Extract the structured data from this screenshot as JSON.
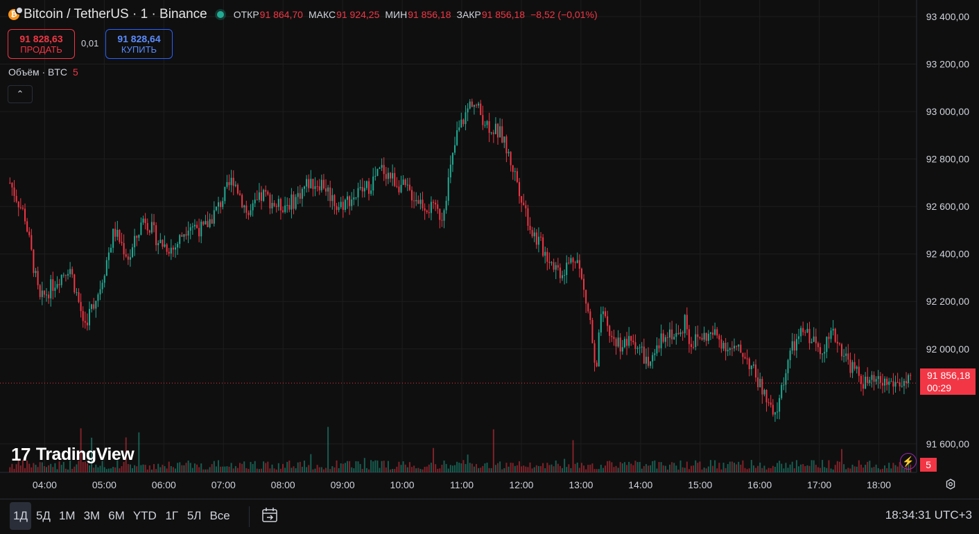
{
  "legend": {
    "coin_glyph": "₿",
    "symbol": "Bitcoin / TetherUS · 1 · Binance",
    "ohlc": [
      {
        "label": "ОТКР",
        "value": "91 864,70"
      },
      {
        "label": "МАКС",
        "value": "91 924,25"
      },
      {
        "label": "МИН",
        "value": "91 856,18"
      },
      {
        "label": "ЗАКР",
        "value": "91 856,18"
      },
      {
        "label": "",
        "value": "−8,52 (−0,01%)"
      }
    ]
  },
  "trade": {
    "sell_price": "91 828,63",
    "sell_label": "ПРОДАТЬ",
    "spread": "0,01",
    "buy_price": "91 828,64",
    "buy_label": "КУПИТЬ"
  },
  "volume_legend": {
    "label": "Объём · BTC",
    "value": "5"
  },
  "collapse_glyph": "⌃",
  "logo": {
    "mark": "17",
    "text": "TradingView"
  },
  "price_axis": {
    "ticks": [
      {
        "value": 93400,
        "label": "93 400,00"
      },
      {
        "value": 93200,
        "label": "93 200,00"
      },
      {
        "value": 93000,
        "label": "93 000,00"
      },
      {
        "value": 92800,
        "label": "92 800,00"
      },
      {
        "value": 92600,
        "label": "92 600,00"
      },
      {
        "value": 92400,
        "label": "92 400,00"
      },
      {
        "value": 92200,
        "label": "92 200,00"
      },
      {
        "value": 92000,
        "label": "92 000,00"
      },
      {
        "value": 91600,
        "label": "91 600,00"
      }
    ],
    "last_price": "91 856,18",
    "last_value": 91856.18,
    "countdown": "00:29",
    "volume_value": "5"
  },
  "time_axis": [
    "04:00",
    "05:00",
    "06:00",
    "07:00",
    "08:00",
    "09:00",
    "10:00",
    "11:00",
    "12:00",
    "13:00",
    "14:00",
    "15:00",
    "16:00",
    "17:00",
    "18:00"
  ],
  "colors": {
    "up": "#22ab94",
    "down": "#f23645",
    "grid": "#1e1e1e",
    "text": "#d1d4dc"
  },
  "chart_data": {
    "type": "candlestick",
    "x": [
      "03:25",
      "03:40",
      "03:55",
      "04:10",
      "04:25",
      "04:40",
      "04:55",
      "05:10",
      "05:25",
      "05:40",
      "05:55",
      "06:10",
      "06:25",
      "06:40",
      "06:55",
      "07:10",
      "07:25",
      "07:40",
      "07:55",
      "08:10",
      "08:25",
      "08:40",
      "08:55",
      "09:10",
      "09:25",
      "09:40",
      "09:55",
      "10:10",
      "10:25",
      "10:40",
      "10:55",
      "11:10",
      "11:25",
      "11:40",
      "11:55",
      "12:10",
      "12:25",
      "12:40",
      "12:55",
      "13:00",
      "13:05",
      "13:10",
      "13:15",
      "13:20",
      "13:30",
      "13:40",
      "13:55",
      "14:10",
      "14:25",
      "14:40",
      "14:45",
      "14:50",
      "15:00",
      "15:15",
      "15:30",
      "15:45",
      "16:00",
      "16:15",
      "16:30",
      "16:45",
      "17:00",
      "17:15",
      "17:30",
      "17:45",
      "18:00",
      "18:10",
      "18:20",
      "18:30",
      "18:33"
    ],
    "close": [
      92700,
      92560,
      92200,
      92280,
      92350,
      92100,
      92250,
      92500,
      92380,
      92560,
      92450,
      92420,
      92530,
      92500,
      92600,
      92720,
      92560,
      92650,
      92600,
      92620,
      92700,
      92700,
      92600,
      92640,
      92680,
      92760,
      92700,
      92650,
      92600,
      92560,
      92900,
      93050,
      92950,
      92900,
      92720,
      92500,
      92400,
      92320,
      92400,
      92300,
      92200,
      92100,
      91860,
      92150,
      92050,
      92020,
      92030,
      91920,
      92080,
      92050,
      92140,
      92020,
      92050,
      92060,
      92000,
      91980,
      91850,
      91700,
      91980,
      92080,
      92000,
      92060,
      91940,
      91856.18,
      91856.18,
      91856.18,
      91856.18,
      91856.18,
      91856.18
    ],
    "ylim": [
      91480,
      93470
    ],
    "volume": {
      "last": 5
    }
  },
  "bottom_bar": {
    "ranges": [
      "1Д",
      "5Д",
      "1М",
      "3М",
      "6М",
      "YTD",
      "1Г",
      "5Л",
      "Все"
    ],
    "active": "1Д",
    "clock": "18:34:31 UTC+3"
  }
}
